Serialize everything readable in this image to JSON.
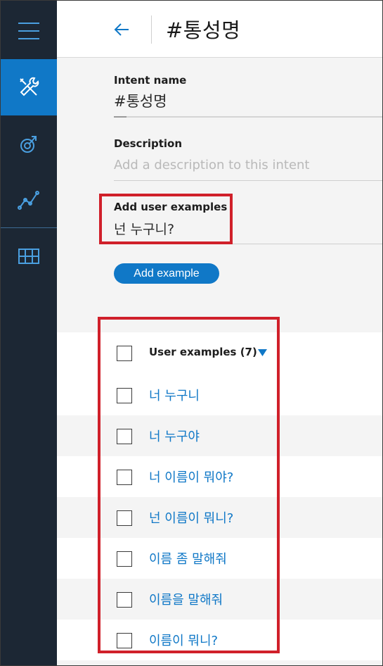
{
  "sidebar": {
    "items": [
      {
        "icon": "hamburger-menu-icon"
      },
      {
        "icon": "tools-icon",
        "active": true
      },
      {
        "icon": "deploy-icon"
      },
      {
        "icon": "analytics-line-icon"
      },
      {
        "icon": "dashboard-grid-icon"
      }
    ]
  },
  "header": {
    "title": "#통성명",
    "back_icon": "arrow-left-icon"
  },
  "form": {
    "intent_name_label": "Intent name",
    "intent_name_value": "#통성명",
    "description_label": "Description",
    "description_placeholder": "Add a description to this intent",
    "user_examples_label": "Add user examples",
    "user_examples_value": "넌 누구니?",
    "add_example_button": "Add example"
  },
  "examples": {
    "header_label": "User examples (7)",
    "sort_icon": "caret-down-icon",
    "items": [
      "너 누구니",
      "너 누구야",
      "너 이름이 뭐야?",
      "넌 이름이 뭐니?",
      "이름 좀 말해줘",
      "이름을 말해줘",
      "이름이 뭐니?"
    ]
  },
  "colors": {
    "sidebar_bg": "#1c2734",
    "accent": "#1078c7",
    "highlight": "#d0202a"
  }
}
